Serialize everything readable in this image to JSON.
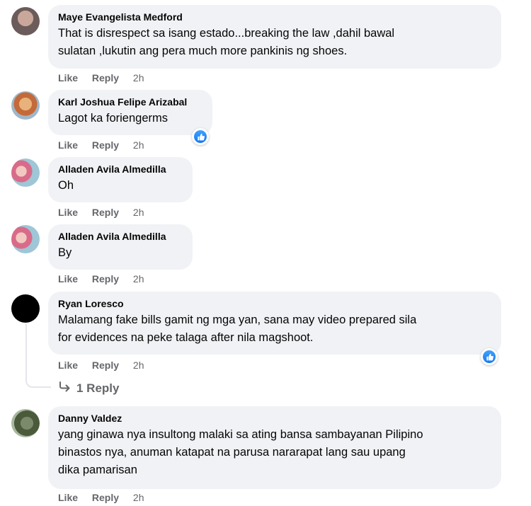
{
  "actions": {
    "like": "Like",
    "reply": "Reply"
  },
  "comments": [
    {
      "author": "Maye Evangelista Medford",
      "lines": [
        "That is disrespect sa isang estado...breaking the law ,dahil bawal",
        "sulatan ,lukutin ang pera much more pankinis ng shoes."
      ],
      "time": "2h"
    },
    {
      "author": "Karl Joshua Felipe Arizabal",
      "lines": [
        "Lagot ka foriengerms"
      ],
      "time": "2h",
      "reaction": "like-icon"
    },
    {
      "author": "Alladen Avila Almedilla",
      "lines": [
        "Oh"
      ],
      "time": "2h"
    },
    {
      "author": "Alladen Avila Almedilla",
      "lines": [
        "By"
      ],
      "time": "2h"
    },
    {
      "author": "Ryan Loresco",
      "lines": [
        "Malamang fake bills gamit ng mga yan, sana may video prepared sila",
        "for evidences na peke talaga after nila magshoot."
      ],
      "time": "2h",
      "reaction": "like-icon"
    },
    {
      "author": "Danny Valdez",
      "lines": [
        "yang ginawa nya insultong malaki sa ating bansa sambayanan Pilipino",
        "binastos nya, anuman katapat na parusa nararapat lang sau upang",
        "dika pamarisan"
      ],
      "time": "2h"
    }
  ],
  "reply_link": {
    "label": "1 Reply",
    "icon": "reply-arrow-icon"
  },
  "colors": {
    "bubble": "#f0f2f5",
    "meta_text": "#65676b",
    "like_blue": "#1877f2"
  }
}
